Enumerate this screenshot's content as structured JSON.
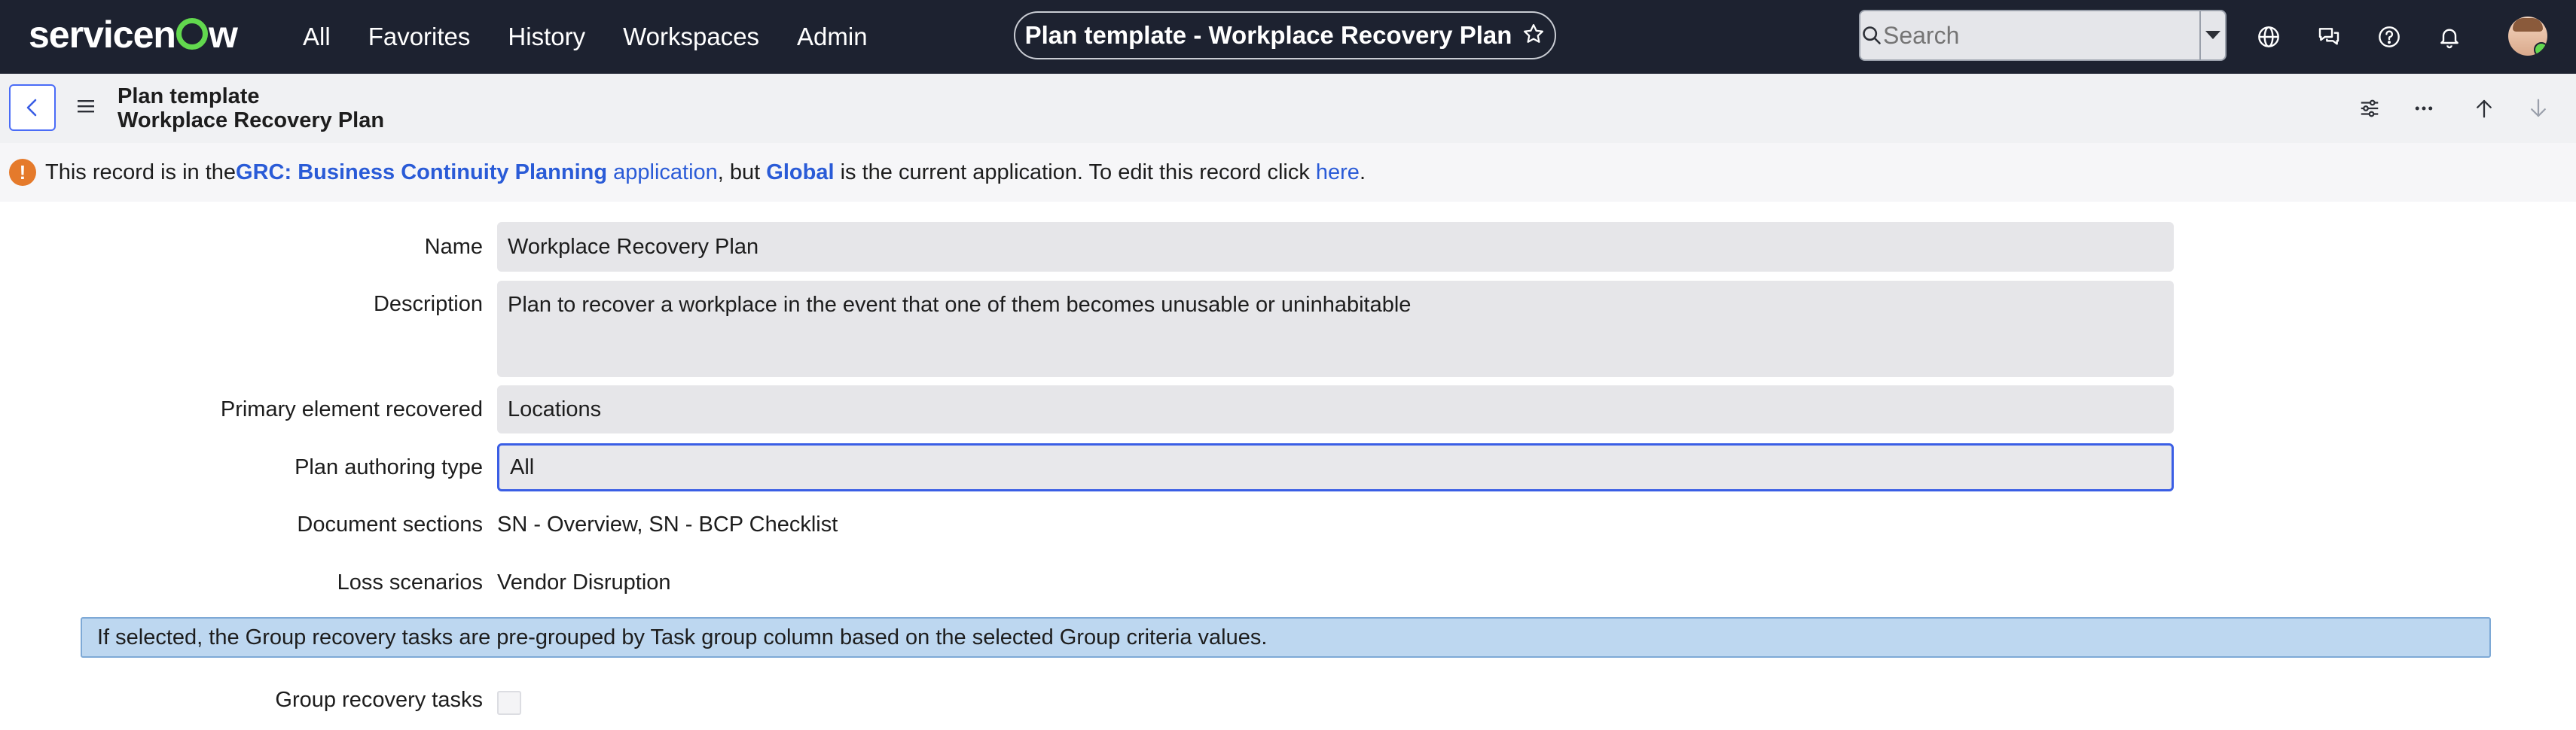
{
  "nav": {
    "logo_pre": "servicen",
    "logo_post": "w",
    "links": [
      "All",
      "Favorites",
      "History",
      "Workspaces",
      "Admin"
    ],
    "context_title": "Plan template - Workplace Recovery Plan",
    "search_placeholder": "Search",
    "icons": [
      "globe-icon",
      "chat-icon",
      "help-icon",
      "bell-icon"
    ]
  },
  "header": {
    "title_line1": "Plan template",
    "title_line2": "Workplace Recovery Plan",
    "icons": [
      "settings-sliders-icon",
      "more-icon",
      "arrow-up-icon",
      "arrow-down-icon"
    ]
  },
  "banner": {
    "text1": "This record is in the ",
    "app_name": "GRC: Business Continuity Planning",
    "app_word": " application",
    "text2": ", but ",
    "scope": "Global",
    "text3": " is the current application. To edit this record click ",
    "link": "here",
    "text4": "."
  },
  "form": {
    "name_label": "Name",
    "name_value": "Workplace Recovery Plan",
    "description_label": "Description",
    "description_value": "Plan to recover a workplace in the event that one of them becomes unusable or uninhabitable",
    "primary_label": "Primary element recovered",
    "primary_value": "Locations",
    "authoring_label": "Plan authoring type",
    "authoring_value": "All",
    "docs_label": "Document sections",
    "docs_value": "SN - Overview, SN - BCP Checklist",
    "loss_label": "Loss scenarios",
    "loss_value": "Vendor Disruption",
    "hint": "If selected, the Group recovery tasks are pre-grouped by Task group column based on the selected Group criteria values.",
    "group_label": "Group recovery tasks",
    "group_checked": false
  }
}
